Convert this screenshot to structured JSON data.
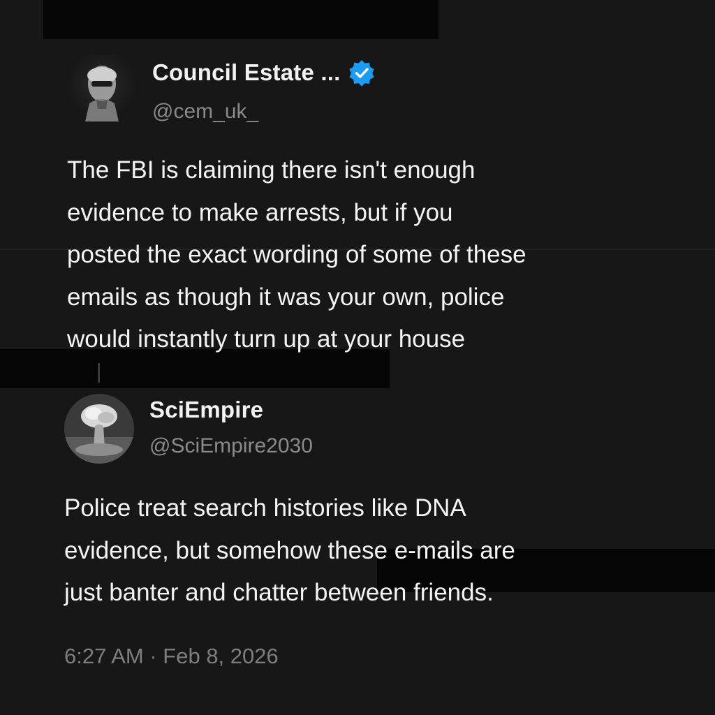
{
  "tweets": [
    {
      "display_name": "Council Estate ...",
      "handle": "@cem_uk_",
      "verified": true,
      "verified_color": "#1d9bf0",
      "avatar": "person-portrait-avatar",
      "text_lines": [
        "The FBI is claiming there isn't enough",
        "evidence to make arrests, but if you",
        "posted the exact wording of some of these",
        "emails as though it was your own, police",
        "would instantly turn up at your house"
      ]
    },
    {
      "display_name": "SciEmpire",
      "handle": "@SciEmpire2030",
      "verified": false,
      "avatar": "mushroom-cloud-avatar",
      "text_lines": [
        "Police treat search histories like DNA",
        "evidence, but somehow these e-mails are",
        "just banter and chatter between friends."
      ],
      "timestamp": "6:27 AM · Feb 8, 2026"
    }
  ],
  "colors": {
    "background": "#171717",
    "text": "#f2f2f2",
    "secondary_text": "#8a8a8a",
    "redaction": "#050505"
  }
}
